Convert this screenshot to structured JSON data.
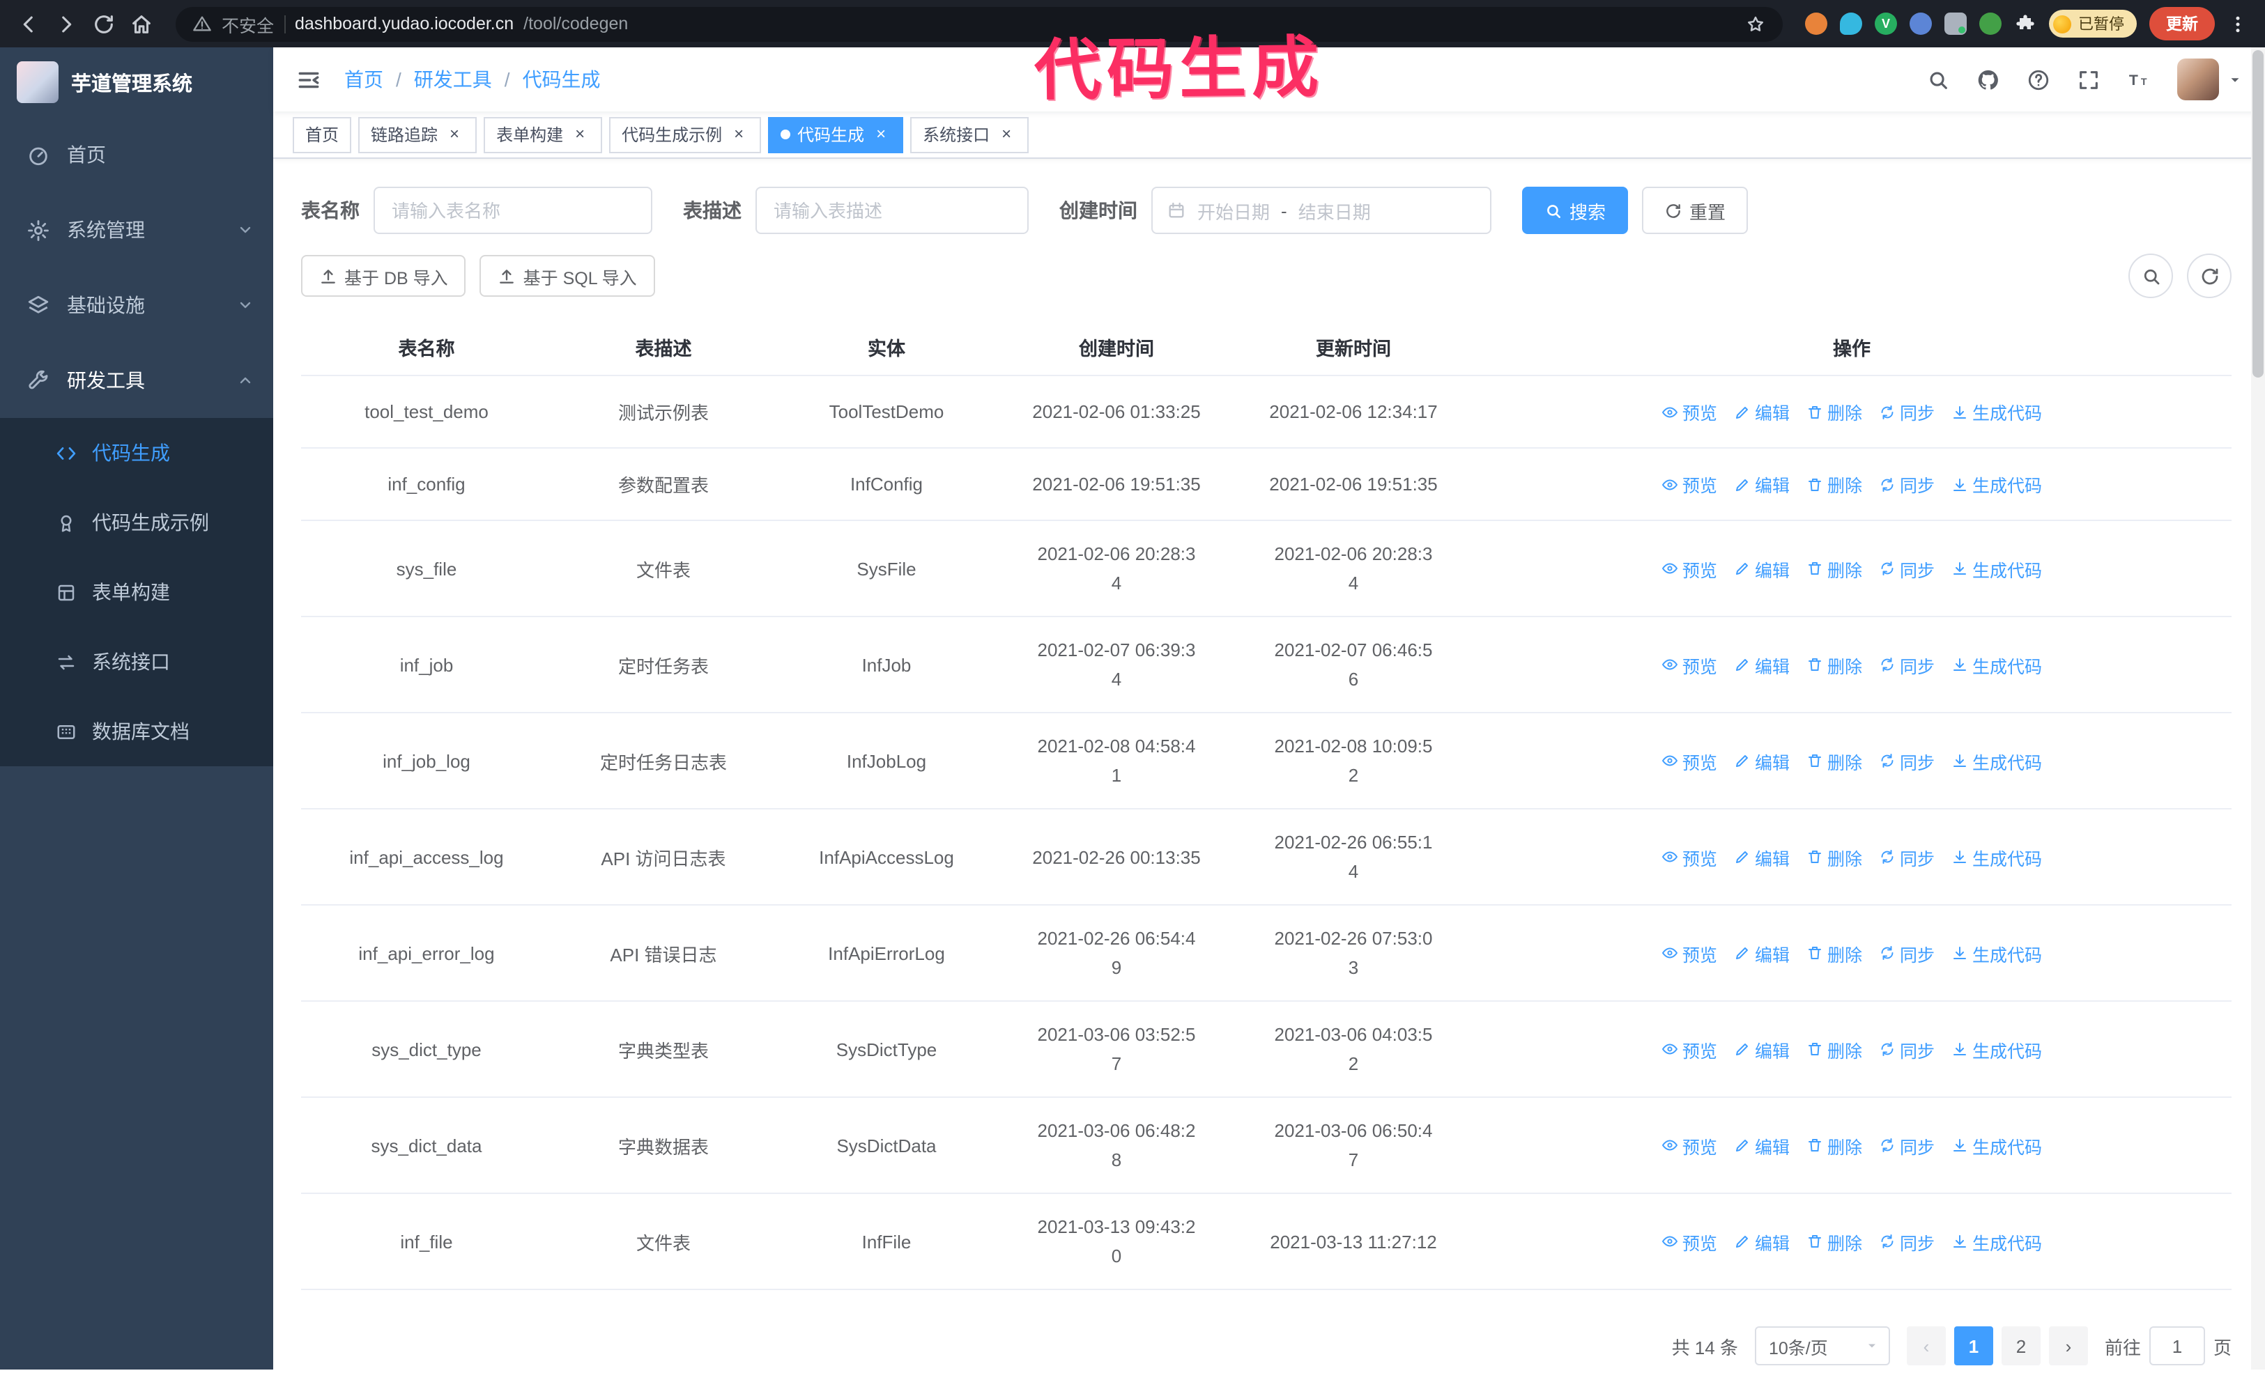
{
  "colors": {
    "accent": "#409eff",
    "sidebar_bg": "#304156",
    "submenu_bg": "#1f2d3d",
    "annotation": "#fb2e63",
    "active_tab_bg": "#409eff"
  },
  "annotation": {
    "text": "代码生成"
  },
  "browser": {
    "insecure": "不安全",
    "host": "dashboard.yudao.iocoder.cn",
    "path": "/tool/codegen",
    "extension_v": "V",
    "paused": "已暂停",
    "update": "更新"
  },
  "icons": {
    "browser": [
      "back-icon",
      "forward-icon",
      "reload-icon",
      "home-icon",
      "warning-icon",
      "star-icon",
      "puzzle-icon",
      "kebab-menu-icon"
    ],
    "header_right": [
      "search-icon",
      "github-icon",
      "help-icon",
      "fullscreen-icon",
      "font-size-icon",
      "caret-down-icon"
    ],
    "table_ops": [
      "eye-icon",
      "pencil-icon",
      "trash-icon",
      "sync-icon",
      "download-icon"
    ]
  },
  "sidebar": {
    "title": "芋道管理系统",
    "items": [
      {
        "label": "首页"
      },
      {
        "label": "系统管理",
        "expandable": true
      },
      {
        "label": "基础设施",
        "expandable": true
      },
      {
        "label": "研发工具",
        "expanded": true
      }
    ],
    "submenu": [
      {
        "label": "代码生成",
        "active": true
      },
      {
        "label": "代码生成示例"
      },
      {
        "label": "表单构建"
      },
      {
        "label": "系统接口"
      },
      {
        "label": "数据库文档"
      }
    ]
  },
  "breadcrumb": {
    "items": [
      "首页",
      "研发工具",
      "代码生成"
    ],
    "sep": "/"
  },
  "tabs": [
    {
      "label": "首页",
      "active": false,
      "closable": false
    },
    {
      "label": "链路追踪",
      "active": false,
      "closable": true
    },
    {
      "label": "表单构建",
      "active": false,
      "closable": true
    },
    {
      "label": "代码生成示例",
      "active": false,
      "closable": true
    },
    {
      "label": "代码生成",
      "active": true,
      "closable": true
    },
    {
      "label": "系统接口",
      "active": false,
      "closable": true
    }
  ],
  "filters": {
    "table_name_label": "表名称",
    "table_name_placeholder": "请输入表名称",
    "table_desc_label": "表描述",
    "table_desc_placeholder": "请输入表描述",
    "create_time_label": "创建时间",
    "date_start_placeholder": "开始日期",
    "date_separator": "-",
    "date_end_placeholder": "结束日期",
    "search_button": "搜索",
    "reset_button": "重置"
  },
  "toolbar": {
    "import_db": "基于 DB 导入",
    "import_sql": "基于 SQL 导入"
  },
  "table": {
    "columns": [
      "表名称",
      "表描述",
      "实体",
      "创建时间",
      "更新时间",
      "操作"
    ],
    "ops": [
      "预览",
      "编辑",
      "删除",
      "同步",
      "生成代码"
    ],
    "rows": [
      {
        "name": "tool_test_demo",
        "desc": "测试示例表",
        "entity": "ToolTestDemo",
        "created": "2021-02-06 01:33:25",
        "updated": "2021-02-06 12:34:17"
      },
      {
        "name": "inf_config",
        "desc": "参数配置表",
        "entity": "InfConfig",
        "created": "2021-02-06 19:51:35",
        "updated": "2021-02-06 19:51:35"
      },
      {
        "name": "sys_file",
        "desc": "文件表",
        "entity": "SysFile",
        "created": "2021-02-06 20:28:3\n4",
        "updated": "2021-02-06 20:28:3\n4"
      },
      {
        "name": "inf_job",
        "desc": "定时任务表",
        "entity": "InfJob",
        "created": "2021-02-07 06:39:3\n4",
        "updated": "2021-02-07 06:46:5\n6"
      },
      {
        "name": "inf_job_log",
        "desc": "定时任务日志表",
        "entity": "InfJobLog",
        "created": "2021-02-08 04:58:4\n1",
        "updated": "2021-02-08 10:09:5\n2"
      },
      {
        "name": "inf_api_access_log",
        "desc": "API 访问日志表",
        "entity": "InfApiAccessLog",
        "created": "2021-02-26 00:13:35",
        "updated": "2021-02-26 06:55:1\n4"
      },
      {
        "name": "inf_api_error_log",
        "desc": "API 错误日志",
        "entity": "InfApiErrorLog",
        "created": "2021-02-26 06:54:4\n9",
        "updated": "2021-02-26 07:53:0\n3"
      },
      {
        "name": "sys_dict_type",
        "desc": "字典类型表",
        "entity": "SysDictType",
        "created": "2021-03-06 03:52:5\n7",
        "updated": "2021-03-06 04:03:5\n2"
      },
      {
        "name": "sys_dict_data",
        "desc": "字典数据表",
        "entity": "SysDictData",
        "created": "2021-03-06 06:48:2\n8",
        "updated": "2021-03-06 06:50:4\n7"
      },
      {
        "name": "inf_file",
        "desc": "文件表",
        "entity": "InfFile",
        "created": "2021-03-13 09:43:2\n0",
        "updated": "2021-03-13 11:27:12"
      }
    ]
  },
  "pagination": {
    "total": "共 14 条",
    "page_size": "10条/页",
    "prev": "‹",
    "pages": [
      "1",
      "2"
    ],
    "active_page": "1",
    "next": "›",
    "goto_label": "前往",
    "goto_value": "1",
    "goto_suffix": "页"
  }
}
